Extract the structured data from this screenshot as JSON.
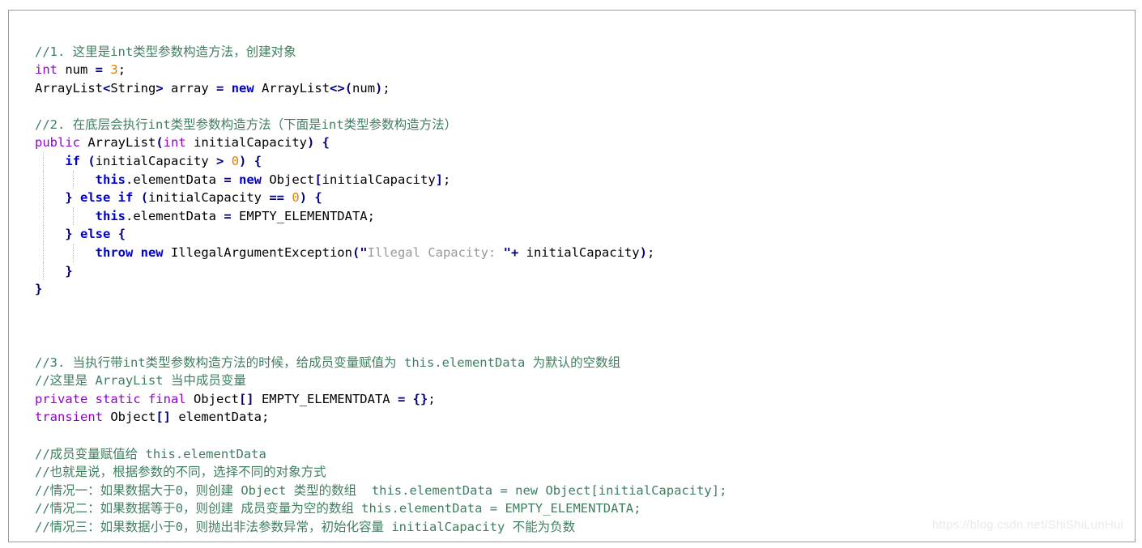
{
  "document": {
    "type": "code-snippet",
    "language": "Java",
    "watermark": "https://blog.csdn.net/ShiShiLunHui",
    "colors": {
      "background": "#ffffff",
      "border": "#9a9a9a",
      "comment": "#3f7f5f",
      "keyword": "#9400d3",
      "keyword_bold": "#0000cc",
      "number": "#e08000",
      "operator": "#00007f",
      "string": "#999999",
      "plain": "#000000",
      "watermark": "#eaeaea"
    }
  },
  "code": {
    "lines": [
      {
        "id": "line-1",
        "indent": 0,
        "guides": 0,
        "tokens": [
          {
            "t": "//1. 这里是int类型参数构造方法，创建对象",
            "c": "cmt"
          }
        ]
      },
      {
        "id": "line-2",
        "indent": 0,
        "guides": 0,
        "tokens": [
          {
            "t": "int",
            "c": "kw"
          },
          {
            "t": " num ",
            "c": "pl"
          },
          {
            "t": "=",
            "c": "op"
          },
          {
            "t": " ",
            "c": "pl"
          },
          {
            "t": "3",
            "c": "num"
          },
          {
            "t": ";",
            "c": "pl"
          }
        ]
      },
      {
        "id": "line-3",
        "indent": 0,
        "guides": 0,
        "tokens": [
          {
            "t": "ArrayList",
            "c": "pl"
          },
          {
            "t": "<",
            "c": "op"
          },
          {
            "t": "String",
            "c": "pl"
          },
          {
            "t": ">",
            "c": "op"
          },
          {
            "t": " array ",
            "c": "pl"
          },
          {
            "t": "=",
            "c": "op"
          },
          {
            "t": " ",
            "c": "pl"
          },
          {
            "t": "new",
            "c": "kwb"
          },
          {
            "t": " ArrayList",
            "c": "pl"
          },
          {
            "t": "<>(",
            "c": "op"
          },
          {
            "t": "num",
            "c": "pl"
          },
          {
            "t": ")",
            "c": "op"
          },
          {
            "t": ";",
            "c": "pl"
          }
        ]
      },
      {
        "id": "line-4",
        "indent": 0,
        "guides": 0,
        "tokens": []
      },
      {
        "id": "line-5",
        "indent": 0,
        "guides": 0,
        "tokens": [
          {
            "t": "//2. 在底层会执行int类型参数构造方法（下面是int类型参数构造方法）",
            "c": "cmt"
          }
        ]
      },
      {
        "id": "line-6",
        "indent": 0,
        "guides": 0,
        "tokens": [
          {
            "t": "public",
            "c": "kw"
          },
          {
            "t": " ArrayList",
            "c": "pl"
          },
          {
            "t": "(",
            "c": "op"
          },
          {
            "t": "int",
            "c": "kw"
          },
          {
            "t": " initialCapacity",
            "c": "pl"
          },
          {
            "t": ") {",
            "c": "op"
          }
        ]
      },
      {
        "id": "line-7",
        "indent": 1,
        "guides": 1,
        "tokens": [
          {
            "t": "    ",
            "c": "pl"
          },
          {
            "t": "if",
            "c": "kwb"
          },
          {
            "t": " ",
            "c": "pl"
          },
          {
            "t": "(",
            "c": "op"
          },
          {
            "t": "initialCapacity ",
            "c": "pl"
          },
          {
            "t": ">",
            "c": "op"
          },
          {
            "t": " ",
            "c": "pl"
          },
          {
            "t": "0",
            "c": "num"
          },
          {
            "t": ") {",
            "c": "op"
          }
        ]
      },
      {
        "id": "line-8",
        "indent": 2,
        "guides": 2,
        "tokens": [
          {
            "t": "        ",
            "c": "pl"
          },
          {
            "t": "this",
            "c": "kwb"
          },
          {
            "t": ".elementData ",
            "c": "pl"
          },
          {
            "t": "=",
            "c": "op"
          },
          {
            "t": " ",
            "c": "pl"
          },
          {
            "t": "new",
            "c": "kwb"
          },
          {
            "t": " Object",
            "c": "pl"
          },
          {
            "t": "[",
            "c": "op"
          },
          {
            "t": "initialCapacity",
            "c": "pl"
          },
          {
            "t": "]",
            "c": "op"
          },
          {
            "t": ";",
            "c": "pl"
          }
        ]
      },
      {
        "id": "line-9",
        "indent": 1,
        "guides": 1,
        "tokens": [
          {
            "t": "    ",
            "c": "pl"
          },
          {
            "t": "}",
            "c": "op"
          },
          {
            "t": " ",
            "c": "pl"
          },
          {
            "t": "else if",
            "c": "kwb"
          },
          {
            "t": " ",
            "c": "pl"
          },
          {
            "t": "(",
            "c": "op"
          },
          {
            "t": "initialCapacity ",
            "c": "pl"
          },
          {
            "t": "==",
            "c": "op"
          },
          {
            "t": " ",
            "c": "pl"
          },
          {
            "t": "0",
            "c": "num"
          },
          {
            "t": ") {",
            "c": "op"
          }
        ]
      },
      {
        "id": "line-10",
        "indent": 2,
        "guides": 2,
        "tokens": [
          {
            "t": "        ",
            "c": "pl"
          },
          {
            "t": "this",
            "c": "kwb"
          },
          {
            "t": ".elementData ",
            "c": "pl"
          },
          {
            "t": "=",
            "c": "op"
          },
          {
            "t": " EMPTY_ELEMENTDATA;",
            "c": "pl"
          }
        ]
      },
      {
        "id": "line-11",
        "indent": 1,
        "guides": 1,
        "tokens": [
          {
            "t": "    ",
            "c": "pl"
          },
          {
            "t": "}",
            "c": "op"
          },
          {
            "t": " ",
            "c": "pl"
          },
          {
            "t": "else",
            "c": "kwb"
          },
          {
            "t": " ",
            "c": "pl"
          },
          {
            "t": "{",
            "c": "op"
          }
        ]
      },
      {
        "id": "line-12",
        "indent": 2,
        "guides": 2,
        "tokens": [
          {
            "t": "        ",
            "c": "pl"
          },
          {
            "t": "throw new",
            "c": "kwb"
          },
          {
            "t": " IllegalArgumentException",
            "c": "pl"
          },
          {
            "t": "(\"",
            "c": "op"
          },
          {
            "t": "Illegal Capacity: ",
            "c": "str"
          },
          {
            "t": "\"+",
            "c": "op"
          },
          {
            "t": " initialCapacity",
            "c": "pl"
          },
          {
            "t": ")",
            "c": "op"
          },
          {
            "t": ";",
            "c": "pl"
          }
        ]
      },
      {
        "id": "line-13",
        "indent": 1,
        "guides": 1,
        "tokens": [
          {
            "t": "    ",
            "c": "pl"
          },
          {
            "t": "}",
            "c": "op"
          }
        ]
      },
      {
        "id": "line-14",
        "indent": 0,
        "guides": 0,
        "tokens": [
          {
            "t": "}",
            "c": "op"
          }
        ]
      },
      {
        "id": "line-15",
        "indent": 0,
        "guides": 0,
        "tokens": []
      },
      {
        "id": "line-16",
        "indent": 0,
        "guides": 0,
        "tokens": []
      },
      {
        "id": "line-17",
        "indent": 0,
        "guides": 0,
        "tokens": []
      },
      {
        "id": "line-18",
        "indent": 0,
        "guides": 0,
        "tokens": [
          {
            "t": "//3. 当执行带int类型参数构造方法的时候，给成员变量赋值为 this.elementData 为默认的空数组",
            "c": "cmt"
          }
        ]
      },
      {
        "id": "line-19",
        "indent": 0,
        "guides": 0,
        "tokens": [
          {
            "t": "//这里是 ArrayList 当中成员变量",
            "c": "cmt"
          }
        ]
      },
      {
        "id": "line-20",
        "indent": 0,
        "guides": 0,
        "tokens": [
          {
            "t": "private static final",
            "c": "kw"
          },
          {
            "t": " Object",
            "c": "pl"
          },
          {
            "t": "[]",
            "c": "op"
          },
          {
            "t": " EMPTY_ELEMENTDATA ",
            "c": "pl"
          },
          {
            "t": "=",
            "c": "op"
          },
          {
            "t": " ",
            "c": "pl"
          },
          {
            "t": "{}",
            "c": "op"
          },
          {
            "t": ";",
            "c": "pl"
          }
        ]
      },
      {
        "id": "line-21",
        "indent": 0,
        "guides": 0,
        "tokens": [
          {
            "t": "transient",
            "c": "kw"
          },
          {
            "t": " Object",
            "c": "pl"
          },
          {
            "t": "[]",
            "c": "op"
          },
          {
            "t": " elementData;",
            "c": "pl"
          }
        ]
      },
      {
        "id": "line-22",
        "indent": 0,
        "guides": 0,
        "tokens": []
      },
      {
        "id": "line-23",
        "indent": 0,
        "guides": 0,
        "tokens": [
          {
            "t": "//成员变量赋值给 this.elementData",
            "c": "cmt"
          }
        ]
      },
      {
        "id": "line-24",
        "indent": 0,
        "guides": 0,
        "tokens": [
          {
            "t": "//也就是说，根据参数的不同，选择不同的对象方式",
            "c": "cmt"
          }
        ]
      },
      {
        "id": "line-25",
        "indent": 0,
        "guides": 0,
        "tokens": [
          {
            "t": "//情况一：如果数据大于0，则创建 Object 类型的数组  this.elementData = new Object[initialCapacity];",
            "c": "cmt"
          }
        ]
      },
      {
        "id": "line-26",
        "indent": 0,
        "guides": 0,
        "tokens": [
          {
            "t": "//情况二：如果数据等于0，则创建 成员变量为空的数组 this.elementData = EMPTY_ELEMENTDATA;",
            "c": "cmt"
          }
        ]
      },
      {
        "id": "line-27",
        "indent": 0,
        "guides": 0,
        "tokens": [
          {
            "t": "//情况三：如果数据小于0，则抛出非法参数异常，初始化容量 initialCapacity 不能为负数",
            "c": "cmt"
          }
        ]
      }
    ]
  }
}
